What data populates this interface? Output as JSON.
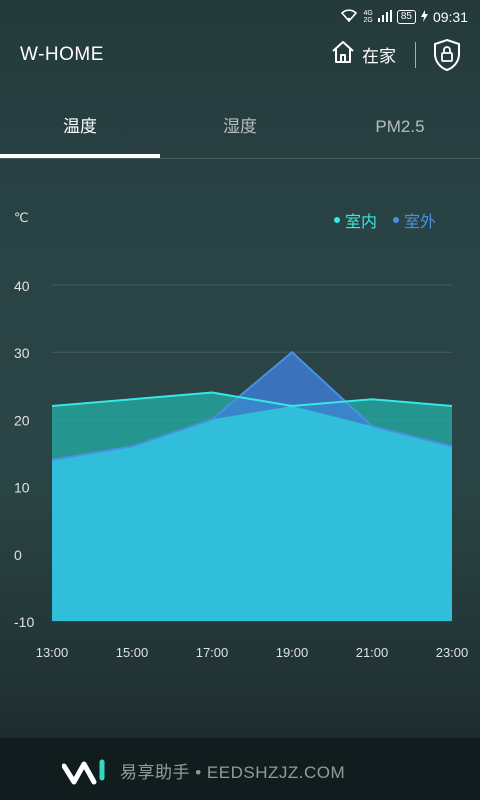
{
  "status": {
    "network": [
      "4G",
      "2G"
    ],
    "battery": "85",
    "time": "09:31"
  },
  "app": {
    "title": "W-HOME",
    "home_label": "在家"
  },
  "tabs": [
    {
      "label": "温度",
      "active": true
    },
    {
      "label": "湿度",
      "active": false
    },
    {
      "label": "PM2.5",
      "active": false
    }
  ],
  "chart_data": {
    "type": "area",
    "ylabel": "℃",
    "x": [
      "13:00",
      "15:00",
      "17:00",
      "19:00",
      "21:00",
      "23:00"
    ],
    "y_ticks": [
      40,
      30,
      20,
      10,
      0,
      -10
    ],
    "ylim": [
      -10,
      40
    ],
    "grid": true,
    "legend_position": "top-right",
    "series": [
      {
        "name": "室内",
        "color": "#35e8e6",
        "values": [
          22,
          23,
          24,
          22,
          23,
          22
        ]
      },
      {
        "name": "室外",
        "color": "#4a90e2",
        "values": [
          14,
          16,
          20,
          30,
          19,
          16
        ]
      }
    ]
  },
  "watermark": {
    "text": "易享助手 • EEDSHZJZ.COM"
  },
  "colors": {
    "indoor": "#35e8e6",
    "outdoor": "#4a90e2",
    "fill": "#2fb8d4"
  }
}
